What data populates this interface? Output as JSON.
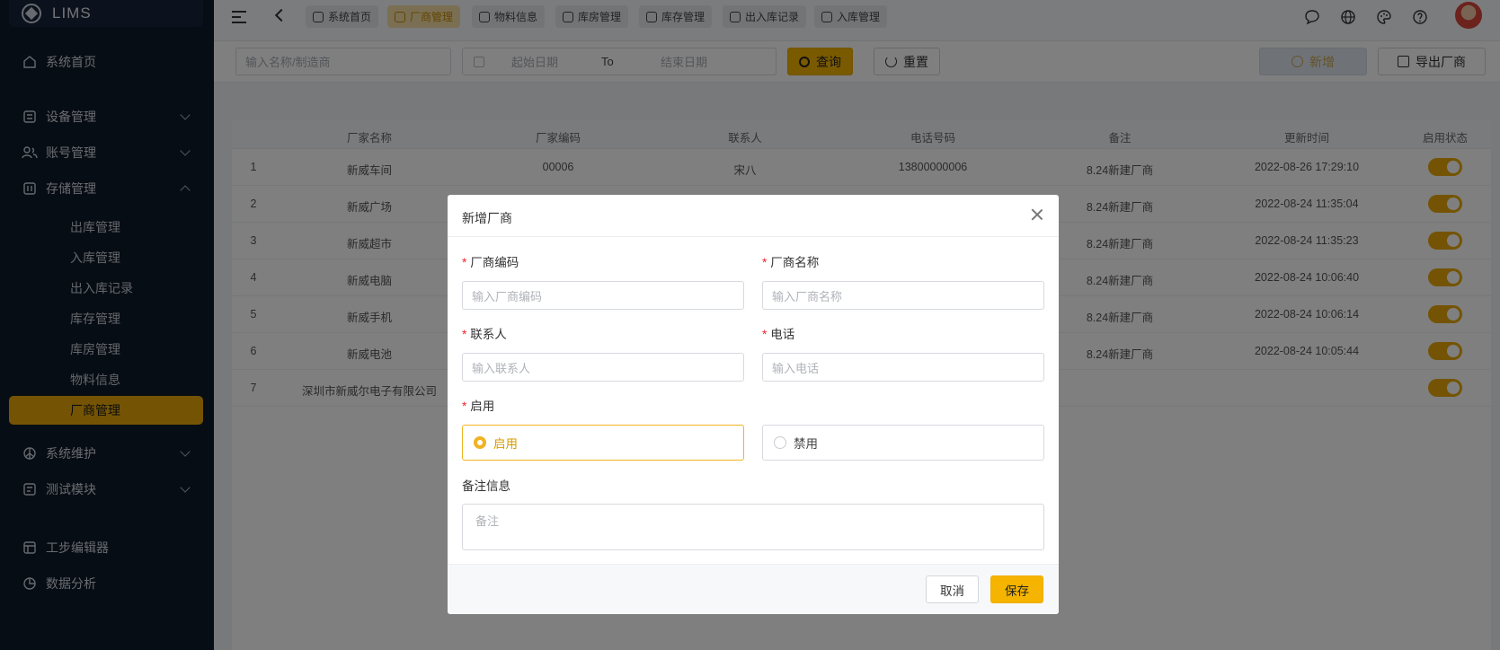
{
  "app": {
    "name": "LIMS"
  },
  "sidebar": {
    "items": [
      {
        "label": "系统首页",
        "icon": "home-icon"
      },
      {
        "label": "设备管理",
        "icon": "device-icon"
      },
      {
        "label": "账号管理",
        "icon": "users-icon"
      },
      {
        "label": "存储管理",
        "icon": "storage-icon"
      },
      {
        "label": "系统维护",
        "icon": "maintenance-icon"
      },
      {
        "label": "测试模块",
        "icon": "test-icon"
      },
      {
        "label": "工步编辑器",
        "icon": "grid-icon"
      },
      {
        "label": "数据分析",
        "icon": "chart-icon"
      }
    ],
    "storage_sub": [
      "出库管理",
      "入库管理",
      "出入库记录",
      "库存管理",
      "库房管理",
      "物料信息",
      "厂商管理"
    ]
  },
  "tabs": [
    "系统首页",
    "厂商管理",
    "物料信息",
    "库房管理",
    "库存管理",
    "出入库记录",
    "入库管理"
  ],
  "filters": {
    "name_placeholder": "输入名称/制造商",
    "start_date": "起始日期",
    "to": "To",
    "end_date": "结束日期",
    "query": "查询",
    "reset": "重置",
    "add": "新增",
    "export": "导出厂商"
  },
  "table": {
    "headers": [
      "厂家名称",
      "厂家编码",
      "联系人",
      "电话号码",
      "备注",
      "更新时间",
      "启用状态"
    ],
    "rows": [
      {
        "idx": "1",
        "name": "新威车间",
        "code": "00006",
        "contact": "宋八",
        "phone": "13800000006",
        "remark": "8.24新建厂商",
        "time": "2022-08-26 17:29:10"
      },
      {
        "idx": "2",
        "name": "新威广场",
        "remark": "8.24新建厂商",
        "time": "2022-08-24 11:35:04"
      },
      {
        "idx": "3",
        "name": "新威超市",
        "remark": "8.24新建厂商",
        "time": "2022-08-24 11:35:23"
      },
      {
        "idx": "4",
        "name": "新威电脑",
        "remark": "8.24新建厂商",
        "time": "2022-08-24 10:06:40"
      },
      {
        "idx": "5",
        "name": "新威手机",
        "remark": "8.24新建厂商",
        "time": "2022-08-24 10:06:14"
      },
      {
        "idx": "6",
        "name": "新威电池",
        "remark": "8.24新建厂商",
        "time": "2022-08-24 10:05:44"
      },
      {
        "idx": "7",
        "name": "深圳市新威尔电子有限公司"
      }
    ]
  },
  "modal": {
    "title": "新增厂商",
    "code_label": "厂商编码",
    "code_placeholder": "输入厂商编码",
    "name_label": "厂商名称",
    "name_placeholder": "输入厂商名称",
    "contact_label": "联系人",
    "contact_placeholder": "输入联系人",
    "phone_label": "电话",
    "phone_placeholder": "输入电话",
    "enable_label": "启用",
    "enable_on": "启用",
    "enable_off": "禁用",
    "remark_label": "备注信息",
    "remark_placeholder": "备注",
    "cancel": "取消",
    "save": "保存"
  },
  "colors": {
    "accent": "#f5b400",
    "sidebar_bg": "#0f1b2b",
    "required": "#f5222d"
  }
}
